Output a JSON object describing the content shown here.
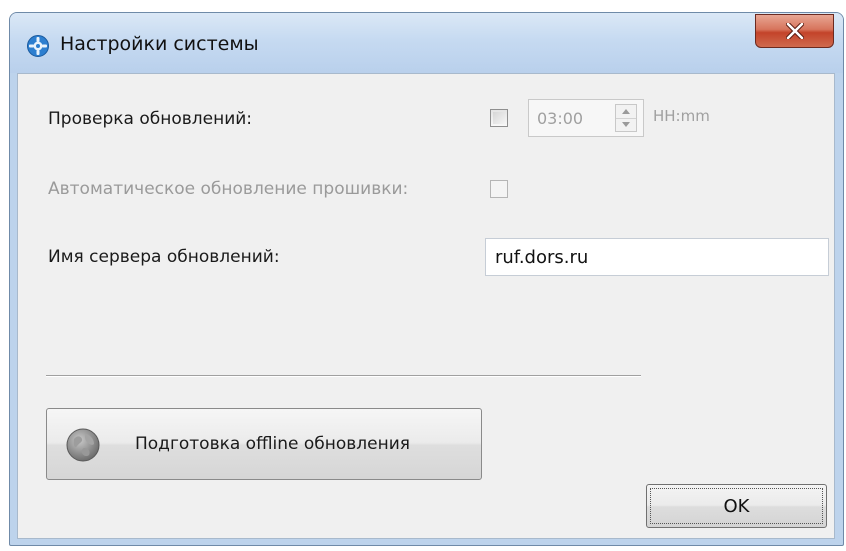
{
  "window": {
    "title": "Настройки системы",
    "icon": "settings-gear-icon",
    "close_icon": "close-x-icon"
  },
  "update_check": {
    "label": "Проверка обновлений:",
    "checked": false,
    "time_value": "03:00",
    "time_format": "HH:mm"
  },
  "firmware": {
    "label": "Автоматическое обновление прошивки:",
    "checked": false,
    "enabled": false
  },
  "server": {
    "label": "Имя сервера обновлений:",
    "value": "ruf.dors.ru"
  },
  "offline_button": {
    "label": "Подготовка offline обновления",
    "icon": "globe-icon"
  },
  "ok_button": {
    "label": "OK"
  },
  "colors": {
    "title_bar": "#c6daf1",
    "close_button": "#c3432a",
    "client_background": "#f0f0f0",
    "disabled_text": "#9a9a9a"
  }
}
